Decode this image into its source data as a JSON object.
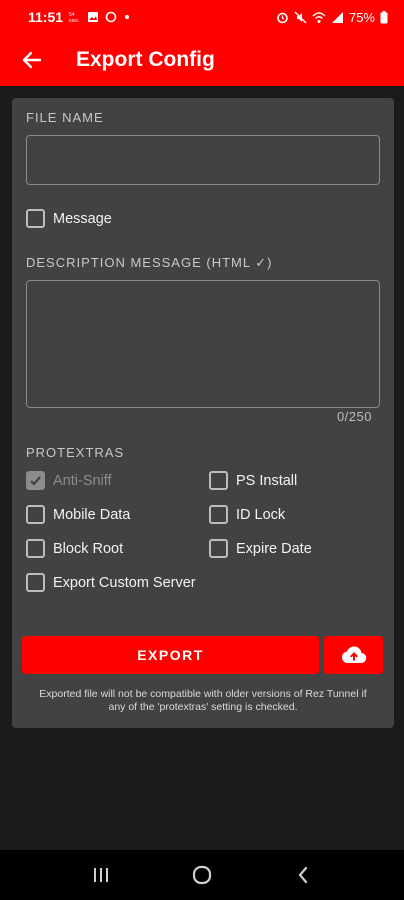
{
  "status_bar": {
    "time": "11:51",
    "small_text": "54\nKB/s",
    "battery": "75%"
  },
  "app_bar": {
    "title": "Export Config"
  },
  "form": {
    "file_name_label": "FILE NAME",
    "file_name_value": "",
    "message_checkbox_label": "Message",
    "message_checked": false,
    "description_label": "DESCRIPTION MESSAGE (HTML ✓)",
    "description_value": "",
    "counter": "0/250",
    "protextras_label": "PROTEXTRAS",
    "protextras": {
      "anti_sniff": "Anti-Sniff",
      "ps_install": "PS Install",
      "mobile_data": "Mobile Data",
      "id_lock": "ID Lock",
      "block_root": "Block Root",
      "expire_date": "Expire Date",
      "export_custom_server": "Export Custom Server"
    },
    "export_label": "EXPORT",
    "note": "Exported file will not be compatible with older versions of Rez Tunnel if any of the 'protextras' setting is checked."
  },
  "colors": {
    "accent": "#ff0000",
    "card": "#424242",
    "background": "#1b1b1b"
  }
}
